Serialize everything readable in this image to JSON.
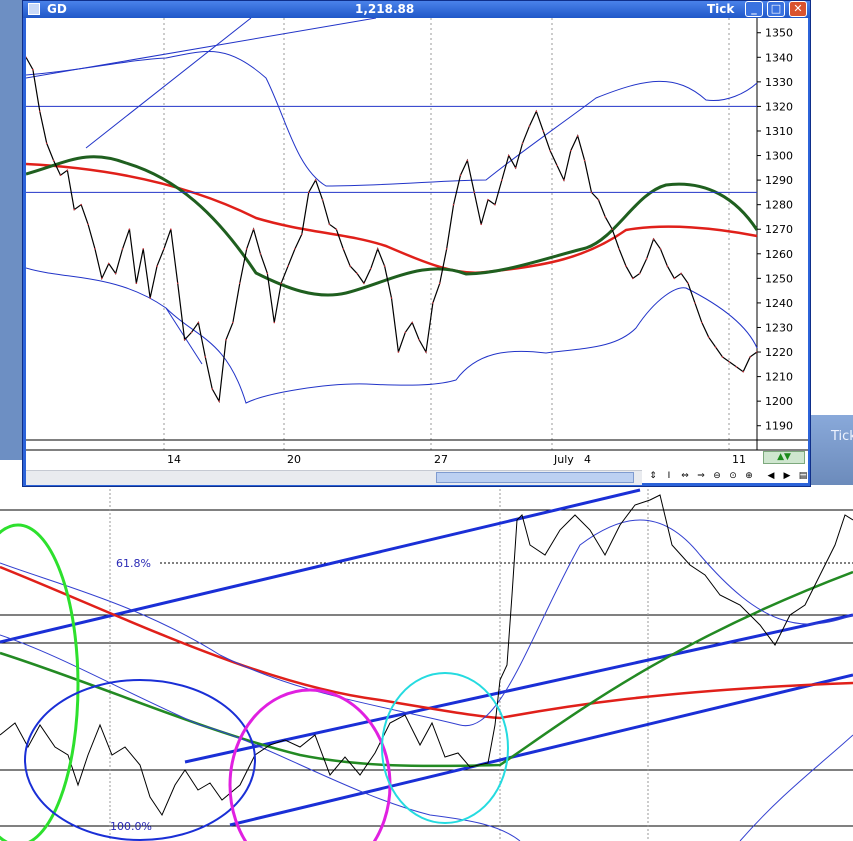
{
  "window": {
    "symbol": "GD",
    "last_price": "1,218.88",
    "timeframe": "Tick",
    "buttons": {
      "minimize": "_",
      "maximize": "□",
      "close": "✕"
    }
  },
  "desktop": {
    "side_label": "Tick"
  },
  "chart_data": {
    "type": "line",
    "title": "",
    "y_axis_ticks": [
      1350,
      1340,
      1330,
      1320,
      1310,
      1300,
      1290,
      1280,
      1270,
      1260,
      1250,
      1240,
      1230,
      1220,
      1210,
      1200,
      1190
    ],
    "x_axis_labels": [
      "14",
      "20",
      "27",
      "July",
      "4",
      "11"
    ],
    "ylim": [
      1185,
      1356
    ],
    "horizontal_lines": [
      1320,
      1285
    ],
    "series": [
      {
        "name": "",
        "color": "#000000",
        "x": [
          0,
          5,
          10,
          15,
          20,
          25,
          30,
          35,
          40,
          45,
          50,
          55,
          60,
          65,
          70,
          75,
          80,
          85,
          90,
          95,
          100,
          105,
          110,
          115,
          120,
          125,
          130,
          135,
          140,
          145,
          150,
          155,
          160,
          165,
          170,
          175,
          180,
          185,
          190,
          195,
          200,
          205,
          210,
          215,
          220,
          225,
          230,
          235,
          240,
          245,
          250,
          255,
          260,
          265,
          270,
          275,
          280,
          285,
          290,
          295,
          300
        ],
        "values": [
          1340,
          1335,
          1318,
          1305,
          1298,
          1292,
          1294,
          1278,
          1280,
          1272,
          1262,
          1250,
          1256,
          1252,
          1262,
          1270,
          1248,
          1262,
          1242,
          1255,
          1262,
          1270,
          1248,
          1225,
          1228,
          1232,
          1218,
          1205,
          1200,
          1225,
          1232,
          1248,
          1262,
          1270,
          1260,
          1252,
          1232,
          1248,
          1255,
          1262,
          1268,
          1285,
          1290,
          1282,
          1272,
          1270,
          1262,
          1255,
          1252,
          1248,
          1254,
          1262,
          1255,
          1242,
          1220,
          1228,
          1232,
          1225,
          1220,
          1240,
          1248
        ]
      },
      {
        "name": "",
        "color": "#000000",
        "x": [
          300,
          305,
          310,
          315,
          320,
          325,
          330,
          335,
          340,
          345,
          350,
          355,
          360,
          365,
          370,
          375,
          380,
          385,
          390,
          395,
          400,
          405,
          410,
          415,
          420,
          425,
          430,
          435,
          440,
          445,
          450,
          455,
          460,
          465,
          470,
          475,
          480,
          485,
          490,
          495,
          500,
          505,
          510,
          515,
          520,
          525,
          530
        ],
        "values": [
          1248,
          1262,
          1280,
          1292,
          1298,
          1285,
          1272,
          1282,
          1280,
          1290,
          1300,
          1295,
          1305,
          1312,
          1318,
          1310,
          1302,
          1296,
          1290,
          1302,
          1308,
          1298,
          1285,
          1282,
          1275,
          1270,
          1262,
          1255,
          1250,
          1252,
          1258,
          1266,
          1262,
          1255,
          1250,
          1252,
          1248,
          1240,
          1232,
          1226,
          1222,
          1218,
          1216,
          1214,
          1212,
          1218,
          1220
        ]
      }
    ]
  },
  "lower_chart": {
    "fib_labels": [
      "61.8%",
      "100.0%"
    ]
  }
}
